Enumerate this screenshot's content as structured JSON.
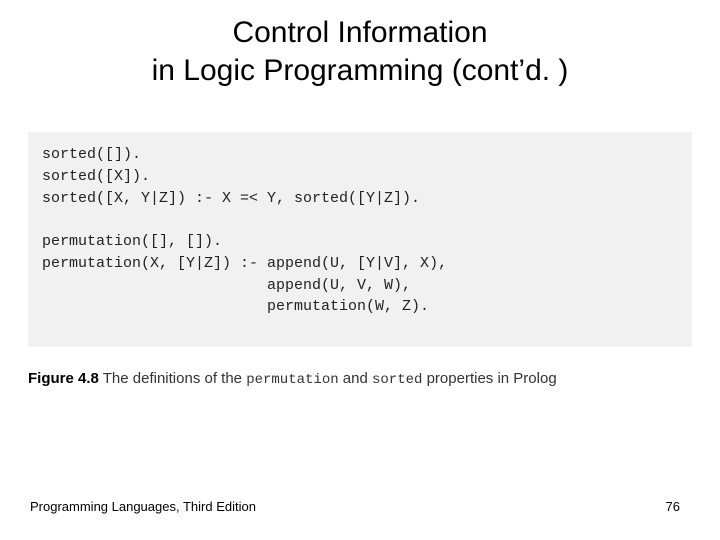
{
  "title_line1": "Control Information",
  "title_line2": "in Logic Programming (cont’d. )",
  "code": "sorted([]).\nsorted([X]).\nsorted([X, Y|Z]) :- X =< Y, sorted([Y|Z]).\n\npermutation([], []).\npermutation(X, [Y|Z]) :- append(U, [Y|V], X),\n                         append(U, V, W),\n                         permutation(W, Z).",
  "caption": {
    "figure_label": "Figure 4.8",
    "before": "The definitions of the ",
    "code1": "permutation",
    "mid": " and ",
    "code2": "sorted",
    "after": " properties in Prolog"
  },
  "footer": {
    "left": "Programming Languages, Third Edition",
    "right": "76"
  }
}
